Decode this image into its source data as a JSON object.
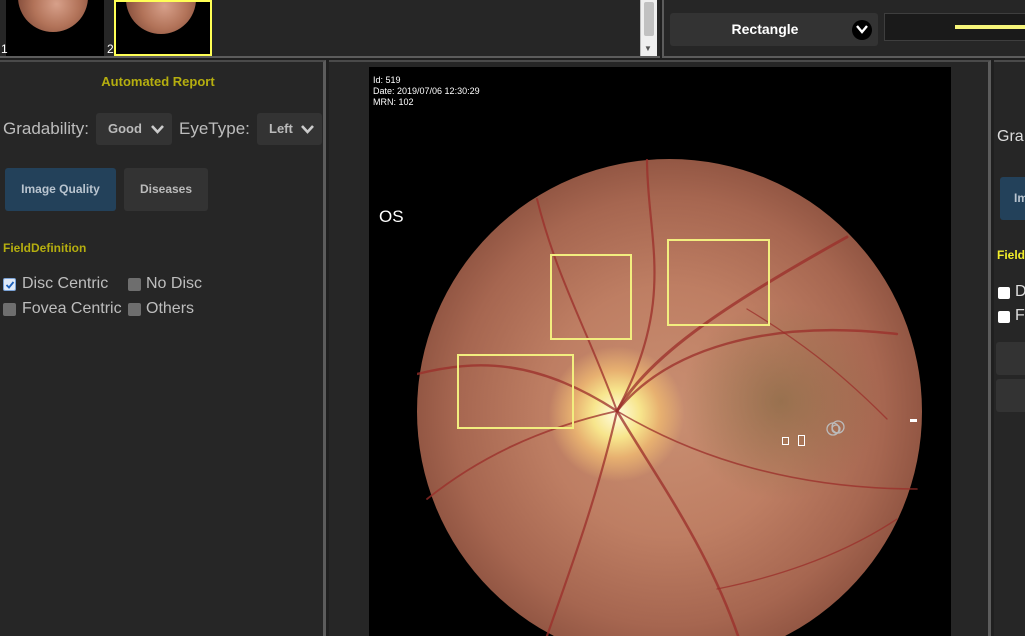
{
  "thumbnails": [
    {
      "number": "1",
      "selected": false
    },
    {
      "number": "2",
      "selected": true
    }
  ],
  "toolbar": {
    "shape_value": "Rectangle",
    "shape_chevron_icon": "chevron-down-icon",
    "line_color": "#f6f57a"
  },
  "left_panel": {
    "title": "Automated Report",
    "gradability": {
      "label": "Gradability:",
      "value": "Good"
    },
    "eye_type": {
      "label": "EyeType:",
      "value": "Left"
    },
    "tabs": [
      {
        "label": "Image Quality",
        "active": true
      },
      {
        "label": "Diseases",
        "active": false
      }
    ],
    "field_definition": {
      "title": "FieldDefinition",
      "options": [
        {
          "label": "Disc Centric",
          "checked": true
        },
        {
          "label": "No Disc",
          "checked": false
        },
        {
          "label": "Fovea Centric",
          "checked": false
        },
        {
          "label": "Others",
          "checked": false
        }
      ]
    }
  },
  "viewer": {
    "meta": {
      "id": "Id: 519",
      "date": "Date: 2019/07/06 12:30:29",
      "mrn": "MRN: 102"
    },
    "eye_label": "OS",
    "annotation_color": "#f2ee7f"
  },
  "right_panel": {
    "gradability_partial": "Gra",
    "button_partial": "Im",
    "field_partial": "Field",
    "checkbox_partials": [
      "D",
      "F"
    ]
  },
  "colors": {
    "accent_yellow": "#b5ae0f",
    "active_tab": "#23415a",
    "panel_bg": "#262626"
  }
}
